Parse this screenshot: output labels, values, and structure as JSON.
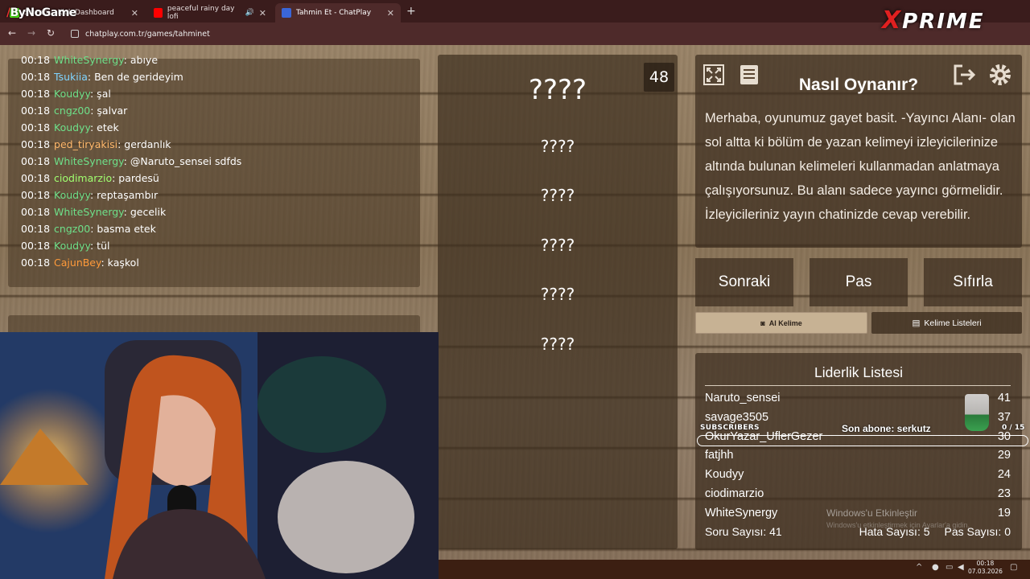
{
  "browser": {
    "tabs": [
      {
        "label": "Stream - Kick Dashboard",
        "active": false
      },
      {
        "label": "peaceful rainy day lofi",
        "active": false
      },
      {
        "label": "Tahmin Et - ChatPlay",
        "active": true
      }
    ],
    "url": "chatplay.com.tr/games/tahminet"
  },
  "overlay_logos": {
    "left": "ByNoGame",
    "right": "PRIME"
  },
  "chat": {
    "messages": [
      {
        "time": "00:18",
        "user": "WhiteSynergy",
        "color": "#6ee08a",
        "text": ": abıye"
      },
      {
        "time": "00:18",
        "user": "Tsukiia",
        "color": "#7fd4ff",
        "text": ": Ben de gerideyim"
      },
      {
        "time": "00:18",
        "user": "Koudyy",
        "color": "#6ee08a",
        "text": ": şal"
      },
      {
        "time": "00:18",
        "user": "cngz00",
        "color": "#6ee08a",
        "text": ": şalvar"
      },
      {
        "time": "00:18",
        "user": "Koudyy",
        "color": "#6ee08a",
        "text": ": etek"
      },
      {
        "time": "00:18",
        "user": "ped_tiryakisi",
        "color": "#ffb86b",
        "text": ": gerdanlık"
      },
      {
        "time": "00:18",
        "user": "WhiteSynergy",
        "color": "#6ee08a",
        "text": ": @Naruto_sensei sdfds"
      },
      {
        "time": "00:18",
        "user": "ciodimarzio",
        "color": "#a0ff70",
        "text": ": pardesü"
      },
      {
        "time": "00:18",
        "user": "Koudyy",
        "color": "#6ee08a",
        "text": ": reptaşambır"
      },
      {
        "time": "00:18",
        "user": "WhiteSynergy",
        "color": "#6ee08a",
        "text": ": gecelik"
      },
      {
        "time": "00:18",
        "user": "cngz00",
        "color": "#6ee08a",
        "text": ": basma etek"
      },
      {
        "time": "00:18",
        "user": "Koudyy",
        "color": "#6ee08a",
        "text": ": tül"
      },
      {
        "time": "00:18",
        "user": "CajunBey",
        "color": "#ff9a3a",
        "text": ": kaşkol"
      }
    ]
  },
  "game": {
    "timer": "48",
    "main_word": "????",
    "forbidden_words": [
      "????",
      "????",
      "????",
      "????",
      "????"
    ]
  },
  "info": {
    "title": "Nasıl Oynanır?",
    "body": "Merhaba, oyunumuz gayet basit. -Yayıncı Alanı- olan sol altta ki bölüm de yazan kelimeyi izleyicilerinize altında bulunan kelimeleri kullanmadan anlatmaya çalışıyorsunuz. Bu alanı sadece yayıncı görmelidir. İzleyicileriniz yayın chatinizde cevap verebilir."
  },
  "buttons": {
    "next": "Sonraki",
    "pass": "Pas",
    "reset": "Sıfırla",
    "ai_word": "AI Kelime",
    "word_lists": "Kelime Listeleri"
  },
  "leaderboard": {
    "title": "Liderlik Listesi",
    "rows": [
      {
        "name": "Naruto_sensei",
        "score": "41"
      },
      {
        "name": "savage3505",
        "score": "37"
      },
      {
        "name": "OkurYazar_UflerGezer",
        "score": "30"
      },
      {
        "name": "fatjhh",
        "score": "29"
      },
      {
        "name": "Koudyy",
        "score": "24"
      },
      {
        "name": "ciodimarzio",
        "score": "23"
      },
      {
        "name": "WhiteSynergy",
        "score": "19"
      }
    ],
    "question_count": "Soru Sayısı: 41",
    "error_count": "Hata Sayısı: 5",
    "pass_count": "Pas Sayısı: 0"
  },
  "stream_overlay": {
    "subscribers_label": "SUBSCRIBERS",
    "last_sub": "Son abone: serkutz",
    "sub_count": "0 / 15",
    "watermark_title": "Windows'u Etkinleştir",
    "watermark_sub": "Windows'u etkinleştirmek için Ayarlar'a gidin."
  },
  "taskbar": {
    "time": "00:18",
    "date": "07.03.2026"
  }
}
